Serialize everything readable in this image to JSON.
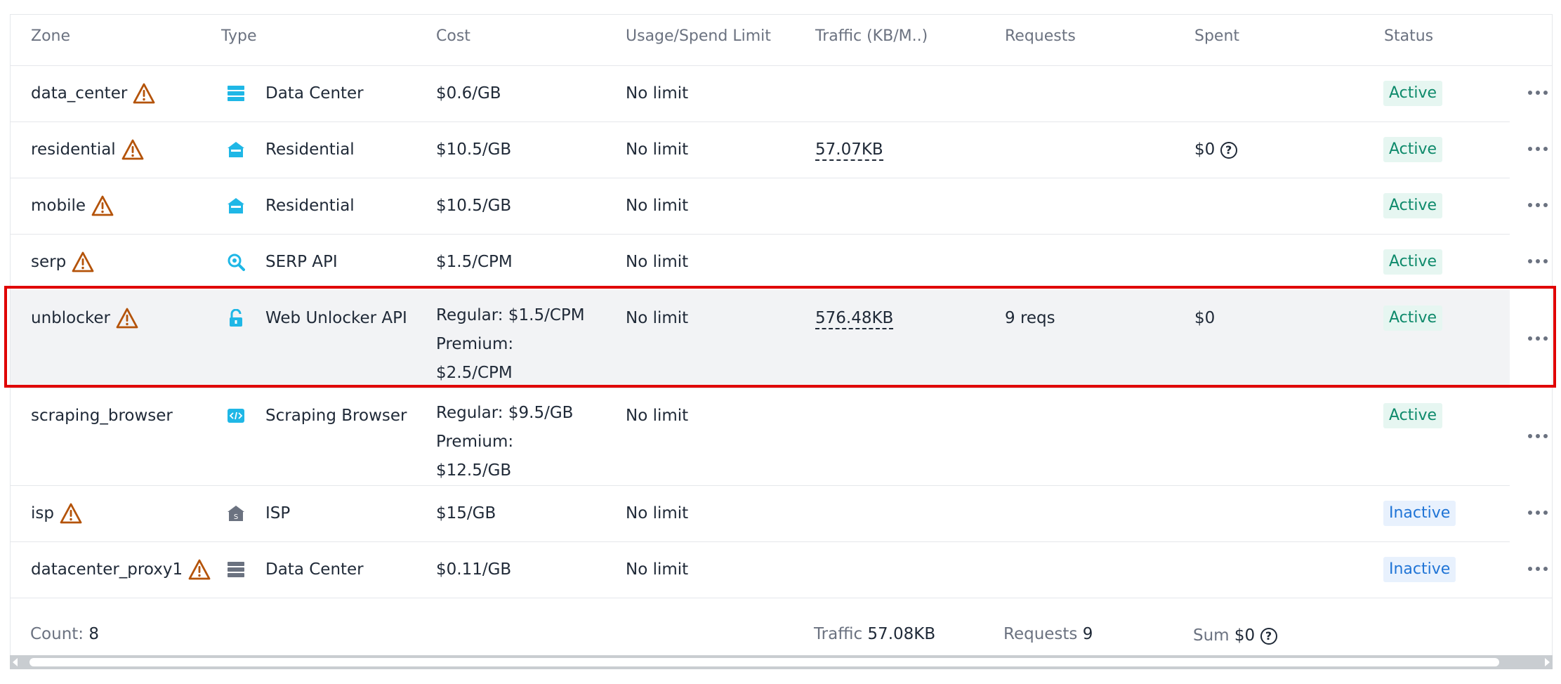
{
  "headers": {
    "zone": "Zone",
    "type": "Type",
    "cost": "Cost",
    "limit": "Usage/Spend Limit",
    "traffic": "Traffic (KB/M..)",
    "requests": "Requests",
    "spent": "Spent",
    "status": "Status"
  },
  "rows": [
    {
      "zone": "data_center",
      "type": "Data Center",
      "type_icon": "server-icon",
      "cost": "$0.6/GB",
      "limit": "No limit",
      "traffic": "",
      "requests": "",
      "spent": "",
      "status": "Active"
    },
    {
      "zone": "residential",
      "type": "Residential",
      "type_icon": "house-icon",
      "cost": "$10.5/GB",
      "limit": "No limit",
      "traffic": "57.07KB",
      "requests": "",
      "spent": "$0",
      "status": "Active"
    },
    {
      "zone": "mobile",
      "type": "Residential",
      "type_icon": "house-icon",
      "cost": "$10.5/GB",
      "limit": "No limit",
      "traffic": "",
      "requests": "",
      "spent": "",
      "status": "Active"
    },
    {
      "zone": "serp",
      "type": "SERP API",
      "type_icon": "search-gear-icon",
      "cost": "$1.5/CPM",
      "limit": "No limit",
      "traffic": "",
      "requests": "",
      "spent": "",
      "status": "Active"
    },
    {
      "zone": "unblocker",
      "type": "Web Unlocker API",
      "type_icon": "unlock-icon",
      "cost_lines": [
        "Regular: $1.5/CPM",
        "Premium:",
        "$2.5/CPM"
      ],
      "limit": "No limit",
      "traffic": "576.48KB",
      "requests": "9 reqs",
      "spent": "$0",
      "status": "Active"
    },
    {
      "zone": "scraping_browser",
      "type": "Scraping Browser",
      "type_icon": "code-icon",
      "cost_lines": [
        "Regular: $9.5/GB",
        "Premium:",
        "$12.5/GB"
      ],
      "limit": "No limit",
      "traffic": "",
      "requests": "",
      "spent": "",
      "status": "Active"
    },
    {
      "zone": "isp",
      "type": "ISP",
      "type_icon": "isp-house-icon",
      "cost": "$15/GB",
      "limit": "No limit",
      "traffic": "",
      "requests": "",
      "spent": "",
      "status": "Inactive"
    },
    {
      "zone": "datacenter_proxy1",
      "type": "Data Center",
      "type_icon": "server-icon",
      "cost": "$0.11/GB",
      "limit": "No limit",
      "traffic": "",
      "requests": "",
      "spent": "",
      "status": "Inactive"
    }
  ],
  "footer": {
    "count_label": "Count:",
    "count_value": "8",
    "traffic_label": "Traffic",
    "traffic_value": "57.08KB",
    "requests_label": "Requests",
    "requests_value": "9",
    "sum_label": "Sum",
    "sum_value": "$0"
  },
  "help_glyph": "?",
  "colors": {
    "warning": "#b45309",
    "type_icon_blue": "#1fb7e6",
    "type_icon_gray": "#6b7280",
    "active_bg": "#e6f6f1",
    "active_text": "#0e8a6b",
    "inactive_bg": "#e8f1fd",
    "inactive_text": "#1f74d6",
    "highlight_border": "#e00000"
  }
}
